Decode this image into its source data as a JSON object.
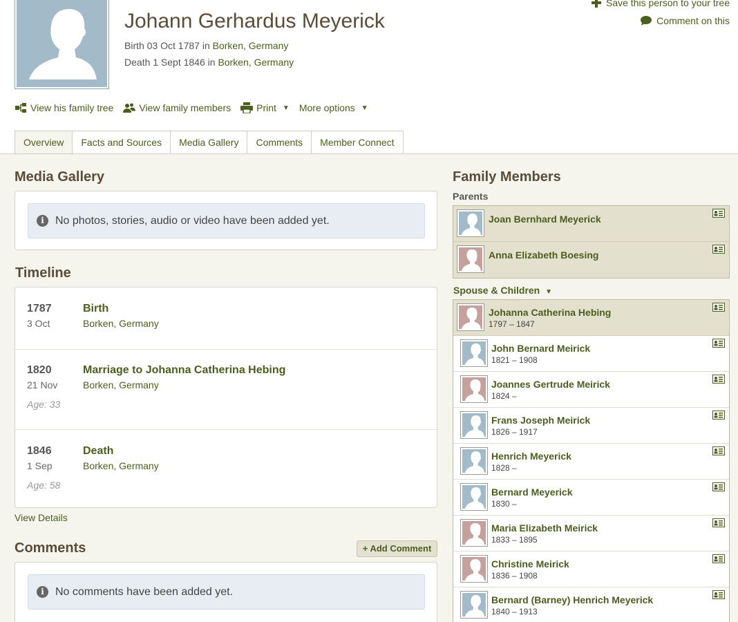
{
  "person": {
    "name": "Johann Gerhardus Meyerick",
    "birth_prefix": "Birth 03 Oct 1787 in ",
    "birth_place": "Borken, Germany",
    "death_prefix": "Death 1 Sept 1846 in ",
    "death_place": "Borken, Germany"
  },
  "top_actions": {
    "save": "Save this person to your tree",
    "comment": "Comment on this"
  },
  "tools": {
    "family_tree": "View his family tree",
    "family_members": "View family members",
    "print": "Print",
    "more": "More options"
  },
  "tabs": [
    "Overview",
    "Facts and Sources",
    "Media Gallery",
    "Comments",
    "Member Connect"
  ],
  "media": {
    "title": "Media Gallery",
    "empty": "No photos, stories, audio or video have been added yet."
  },
  "timeline": {
    "title": "Timeline",
    "events": [
      {
        "year": "1787",
        "date": "3 Oct",
        "title": "Birth",
        "place": "Borken, Germany",
        "age": ""
      },
      {
        "year": "1820",
        "date": "21 Nov",
        "title": "Marriage to Johanna Catherina Hebing",
        "place": "Borken, Germany",
        "age": "Age: 33"
      },
      {
        "year": "1846",
        "date": "1 Sep",
        "title": "Death",
        "place": "Borken, Germany",
        "age": "Age: 58"
      }
    ],
    "view_details": "View Details"
  },
  "comments": {
    "title": "Comments",
    "add": "+ Add Comment",
    "empty": "No comments have been added yet."
  },
  "family": {
    "title": "Family Members",
    "parents_label": "Parents",
    "spouse_label": "Spouse & Children",
    "parents": [
      {
        "name": "Joan Bernhard Meyerick",
        "dates": "",
        "gender": "male"
      },
      {
        "name": "Anna Elizabeth Boesing",
        "dates": "",
        "gender": "female"
      }
    ],
    "spouse": {
      "name": "Johanna Catherina Hebing",
      "dates": "1797 – 1847",
      "gender": "female"
    },
    "children": [
      {
        "name": "John Bernard Meirick",
        "dates": "1821 – 1908",
        "gender": "male"
      },
      {
        "name": "Joannes Gertrude Meirick",
        "dates": "1824 –",
        "gender": "female"
      },
      {
        "name": "Frans Joseph Meirick",
        "dates": "1826 – 1917",
        "gender": "male"
      },
      {
        "name": "Henrich Meyerick",
        "dates": "1828 –",
        "gender": "male"
      },
      {
        "name": "Bernard Meyerick",
        "dates": "1830 –",
        "gender": "male"
      },
      {
        "name": "Maria Elizabeth Meirick",
        "dates": "1833 – 1895",
        "gender": "female"
      },
      {
        "name": "Christine Meirick",
        "dates": "1836 – 1908",
        "gender": "female"
      },
      {
        "name": "Bernard (Barney) Henrich Meyerick",
        "dates": "1840 – 1913",
        "gender": "male"
      }
    ]
  },
  "colors": {
    "link": "#4b5e1f",
    "male": "#a3bac9",
    "female": "#c5a19d",
    "highlight": "#e3e0cd"
  }
}
